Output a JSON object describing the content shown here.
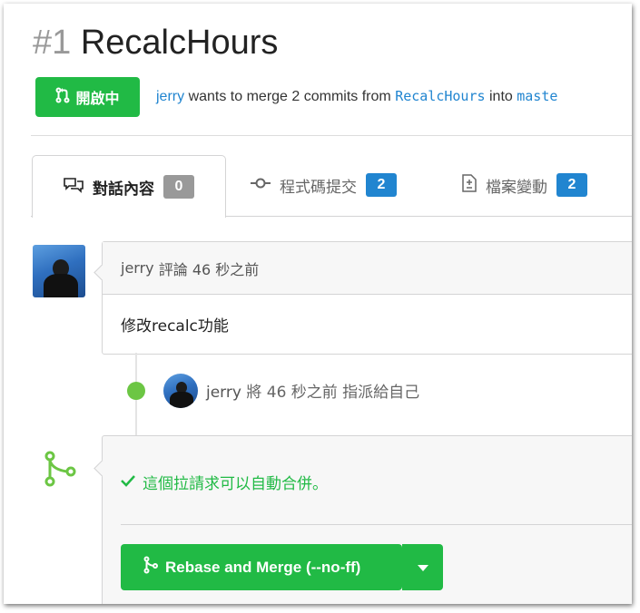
{
  "pull_request": {
    "number": "#1",
    "title": "RecalcHours",
    "state_label": "開啟中",
    "author": "jerry",
    "merge_text_1": "wants to merge 2 commits from",
    "head_branch": "RecalcHours",
    "merge_text_2": "into",
    "base_branch": "maste"
  },
  "tabs": [
    {
      "label": "對話內容",
      "count": "0",
      "icon": "conversation-icon"
    },
    {
      "label": "程式碼提交",
      "count": "2",
      "icon": "commit-icon"
    },
    {
      "label": "檔案變動",
      "count": "2",
      "icon": "file-diff-icon"
    }
  ],
  "comment": {
    "author": "jerry",
    "header_text": "評論 46 秒之前",
    "body": "修改recalc功能"
  },
  "event": {
    "author": "jerry",
    "text": "將 46 秒之前 指派給自己"
  },
  "merge": {
    "status": "這個拉請求可以自動合併。",
    "button_label": "Rebase and Merge (--no-ff)"
  },
  "colors": {
    "green": "#21ba45",
    "blue": "#2185d0",
    "grey_badge": "#999999",
    "timeline_dot": "#6cc644"
  }
}
